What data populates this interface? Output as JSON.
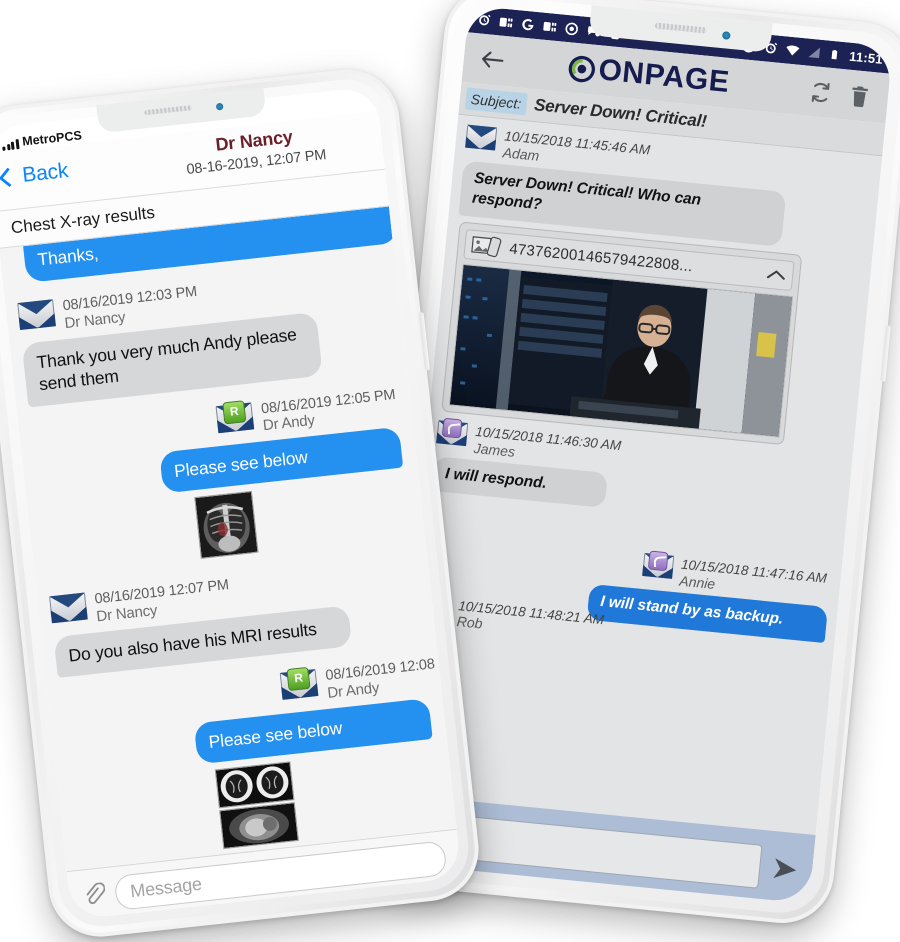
{
  "scene": {
    "description": "Two white smartphones displaying secure clinical and incident messaging apps"
  },
  "left_phone": {
    "platform": "ios",
    "status_bar": {
      "carrier": "MetroPCS",
      "signal_icon": "signal-bars-icon"
    },
    "nav": {
      "back_label": "Back",
      "back_icon": "chevron-left-icon",
      "title": "Dr Nancy",
      "subtitle": "08-16-2019, 12:07 PM"
    },
    "subject": "Chest X-ray results",
    "messages": [
      {
        "id": "msg-thanks",
        "side": "out",
        "clipped": true,
        "text": "Thanks,",
        "meta": null
      },
      {
        "id": "msg-nancy-1203",
        "side": "in",
        "meta": {
          "icon": "envelope-icon",
          "badge": "",
          "time": "08/16/2019 12:03 PM",
          "sender": "Dr Nancy"
        },
        "text": "Thank you very much Andy please send them"
      },
      {
        "id": "msg-andy-1205",
        "side": "out",
        "meta": {
          "icon": "envelope-icon",
          "badge": "R",
          "time": "08/16/2019 12:05 PM",
          "sender": "Dr Andy"
        },
        "text": "Please see below",
        "attachment": "chest-xray-thumbnail"
      },
      {
        "id": "msg-nancy-1207",
        "side": "in",
        "meta": {
          "icon": "envelope-icon",
          "badge": "",
          "time": "08/16/2019 12:07 PM",
          "sender": "Dr Nancy"
        },
        "text": "Do you also have his MRI results"
      },
      {
        "id": "msg-andy-1208",
        "side": "out",
        "meta": {
          "icon": "envelope-icon",
          "badge": "R",
          "time": "08/16/2019 12:08",
          "sender": "Dr Andy"
        },
        "text": "Please see below",
        "attachment": "mri-scan-thumbnails"
      }
    ],
    "input": {
      "placeholder": "Message",
      "attach_icon": "paperclip-icon"
    }
  },
  "right_phone": {
    "platform": "android",
    "status_bar": {
      "left_icons": [
        "alarm-icon",
        "app-icon",
        "google-icon",
        "app-icon",
        "circle-icon",
        "chat-icon",
        "device-icon"
      ],
      "right_icons": [
        "do-not-disturb-icon",
        "alarm-icon",
        "wifi-icon",
        "signal-off-icon",
        "battery-icon"
      ],
      "time": "11:51"
    },
    "app_bar": {
      "back_icon": "arrow-left-icon",
      "logo_text": "ONPAGE",
      "logo_mark_icon": "onpage-swirl-icon",
      "refresh_icon": "refresh-icon",
      "delete_icon": "trash-icon"
    },
    "subject": {
      "label": "Subject:",
      "value": "Server Down! Critical!"
    },
    "messages": [
      {
        "id": "msg-adam",
        "side": "in",
        "meta": {
          "icon": "envelope-icon",
          "badge": "",
          "time": "10/15/2018 11:45:46 AM",
          "sender": "Adam"
        },
        "text": "Server Down! Critical! Who can respond?",
        "attachment": {
          "icon": "image-attachment-icon",
          "id": "47376200146579422808...",
          "collapse_icon": "chevron-up-icon",
          "preview": "server-room-technician-photo"
        }
      },
      {
        "id": "msg-james",
        "side": "in",
        "meta": {
          "icon": "envelope-reply-icon",
          "badge": "reply",
          "time": "10/15/2018 11:46:30 AM",
          "sender": "James"
        },
        "text": "I will respond."
      },
      {
        "id": "msg-annie",
        "side": "out",
        "meta": {
          "icon": "envelope-reply-icon",
          "badge": "reply",
          "time": "10/15/2018 11:47:16 AM",
          "sender": "Annie"
        },
        "text": "I will stand by as backup."
      },
      {
        "id": "msg-rob",
        "side": "in",
        "meta": {
          "icon": "envelope-icon",
          "badge": "",
          "time": "10/15/2018 11:48:21 AM",
          "sender": "Rob"
        },
        "text": ""
      }
    ],
    "input": {
      "attach_icon": "paperclip-plus-icon",
      "value": "",
      "send_icon": "send-arrow-icon"
    }
  },
  "colors": {
    "ios_blue": "#2490f0",
    "ios_link": "#0a84ff",
    "ios_title_maroon": "#6b1f28",
    "ios_bubble_gray": "#d6d7d9",
    "android_status_navy": "#1d2255",
    "android_appbar_gray": "#d3d5d7",
    "android_thread_gray": "#e3e4e5",
    "android_blue": "#2078d8",
    "android_input_blue": "#adbdd6",
    "onpage_navy": "#161c4d",
    "onpage_green": "#7ab648"
  }
}
